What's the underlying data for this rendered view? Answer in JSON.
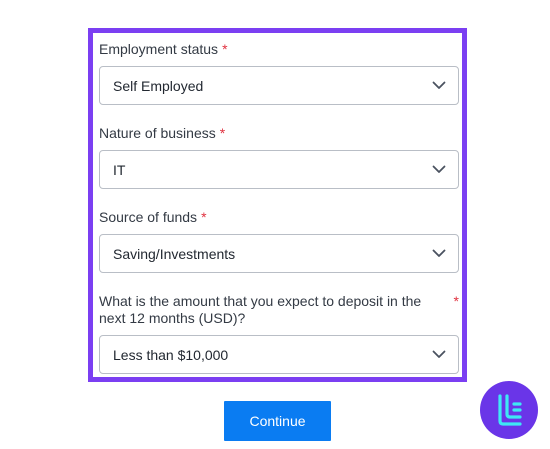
{
  "form": {
    "fields": [
      {
        "label": "Employment status",
        "required_mark": "*",
        "value": "Self Employed"
      },
      {
        "label": "Nature of business",
        "required_mark": "*",
        "value": "IT"
      },
      {
        "label": "Source of funds",
        "required_mark": "*",
        "value": "Saving/Investments"
      },
      {
        "label": "What is the amount that you expect to deposit in the next 12 months (USD)?",
        "required_mark": "*",
        "value": "Less than $10,000"
      }
    ]
  },
  "actions": {
    "continue_label": "Continue"
  },
  "colors": {
    "highlight_border": "#7b3ff2",
    "primary_button": "#0a7cf2",
    "required": "#e0313f",
    "logo_bg": "#6a35e8",
    "logo_mark": "#3ee8f5"
  },
  "icons": {
    "select_toggle": "chevron-down-icon",
    "brand": "brand-logo-icon"
  }
}
